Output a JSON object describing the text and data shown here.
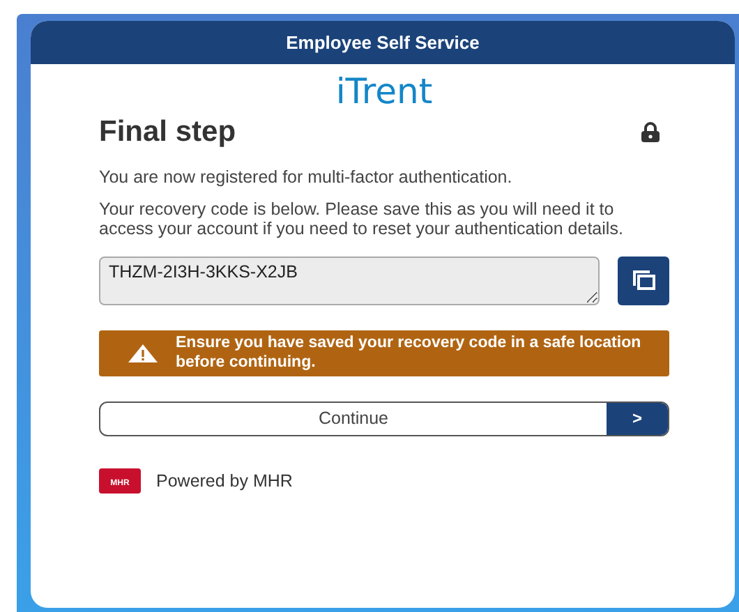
{
  "header": {
    "title": "Employee Self Service"
  },
  "brand": {
    "prefix": "i",
    "name": "Trent"
  },
  "heading": "Final step",
  "paragraphs": [
    "You are now registered for multi-factor authentication.",
    "Your recovery code is below. Please save this as you will need it to access your account if you need to reset your authentication details."
  ],
  "recovery_code": {
    "value": "THZM-2I3H-3KKS-X2JB"
  },
  "warning": "Ensure you have saved your recovery code in a safe location before continuing.",
  "continue_button": {
    "label": "Continue",
    "arrow": ">"
  },
  "footer": {
    "logo": "MHR",
    "text": "Powered by MHR"
  }
}
